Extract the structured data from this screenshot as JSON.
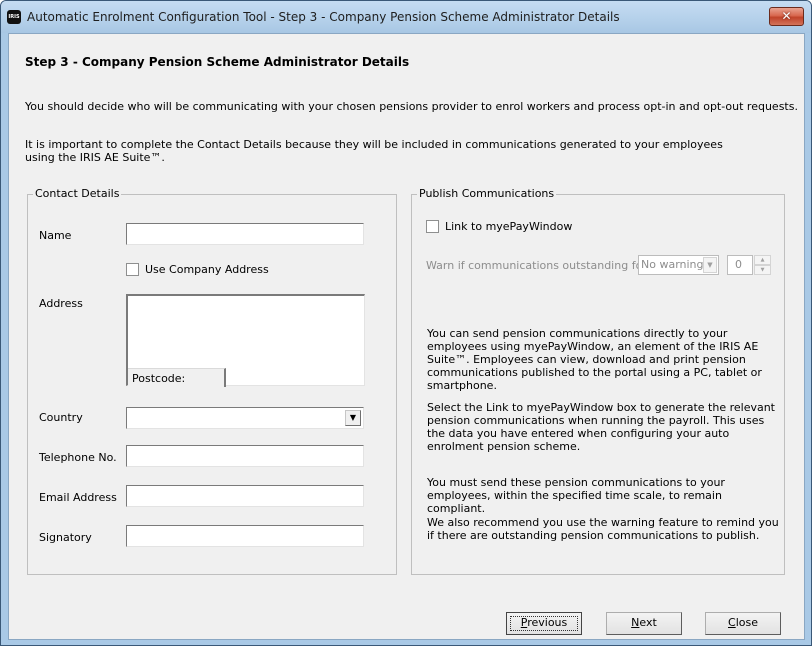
{
  "window": {
    "title": "Automatic Enrolment Configuration Tool - Step 3 - Company Pension Scheme Administrator Details",
    "app_icon_text": "IRIS",
    "close_glyph": "✕"
  },
  "page": {
    "heading": "Step 3 - Company Pension Scheme Administrator Details",
    "paragraph1": "You should decide who will be communicating with your chosen pensions provider to enrol workers and process opt-in and opt-out requests.",
    "paragraph2": "It is important to complete the Contact Details because they will be included in communications generated to your employees using the IRIS AE Suite™."
  },
  "contact_details": {
    "legend": "Contact Details",
    "name_label": "Name",
    "name_value": "",
    "use_company_address_label": "Use Company Address",
    "use_company_address_checked": false,
    "address_label": "Address",
    "address_value": "",
    "postcode_label": "Postcode:",
    "postcode_value": "",
    "country_label": "Country",
    "country_value": "",
    "telephone_label": "Telephone No.",
    "telephone_value": "",
    "email_label": "Email Address",
    "email_value": "",
    "signatory_label": "Signatory",
    "signatory_value": "",
    "dropdown_glyph": "▼"
  },
  "publish_communications": {
    "legend": "Publish Communications",
    "link_label": "Link to myePayWindow",
    "link_checked": false,
    "warn_label": "Warn if communications outstanding for",
    "warn_select_value": "No warning",
    "warn_spin_value": "0",
    "info1": "You can send pension communications directly to your employees using myePayWindow, an element of the IRIS AE Suite™. Employees can view, download and print pension communications published to the portal using a PC, tablet or smartphone.",
    "info2": "Select the Link to myePayWindow box to generate the relevant pension communications when running the payroll. This uses the data you have entered when configuring your auto enrolment pension scheme.",
    "info3": "You must send these pension communications to your employees, within the specified time scale, to remain compliant.",
    "info4": "We also recommend you use the warning feature to remind you if there are outstanding pension communications to publish."
  },
  "buttons": {
    "previous": {
      "accel": "P",
      "rest": "revious"
    },
    "next": {
      "accel": "N",
      "rest": "ext"
    },
    "close": {
      "accel": "C",
      "rest": "lose"
    }
  }
}
